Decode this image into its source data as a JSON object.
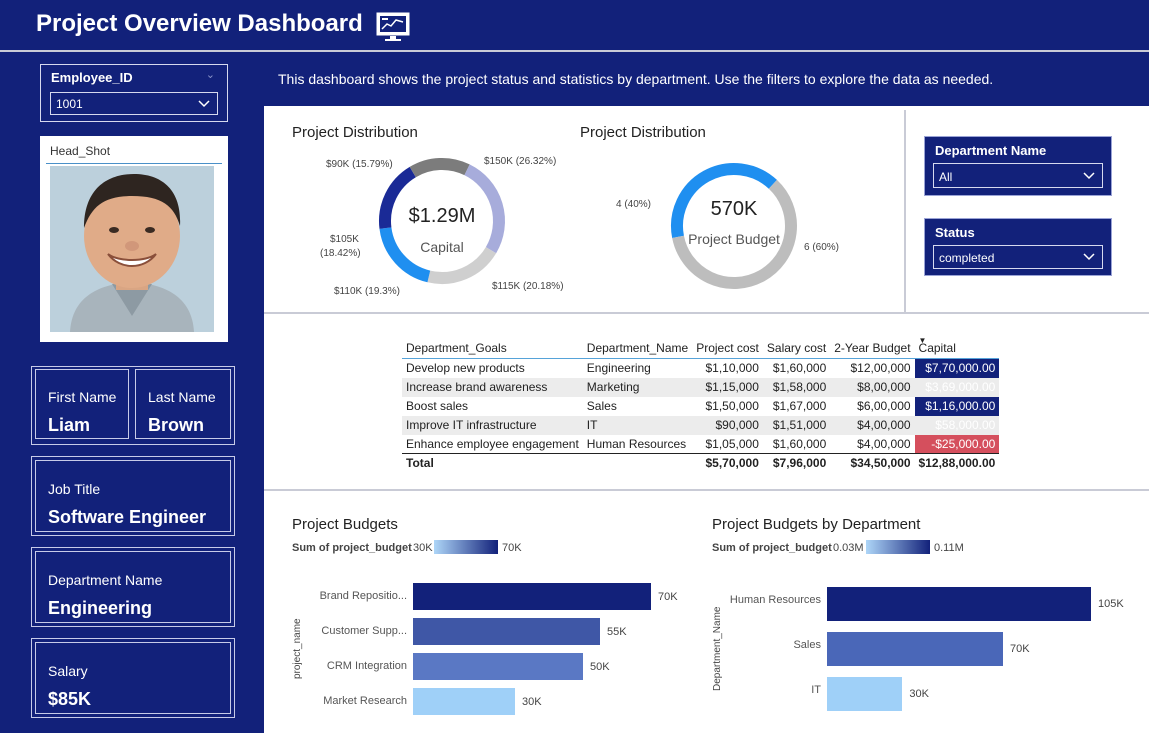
{
  "header": {
    "title": "Project Overview Dashboard",
    "icon": "dashboard-chart-icon"
  },
  "description": "This dashboard shows the project status and statistics by department. Use the filters to explore the data as needed.",
  "employee_slicer": {
    "label": "Employee_ID",
    "value": "1001"
  },
  "head_shot": {
    "label": "Head_Shot"
  },
  "employee": {
    "first_name_label": "First Name",
    "first_name": "Liam",
    "last_name_label": "Last Name",
    "last_name": "Brown",
    "job_title_label": "Job Title",
    "job_title": "Software Engineer",
    "department_label": "Department Name",
    "department": "Engineering",
    "salary_label": "Salary",
    "salary": "$85K"
  },
  "donut1": {
    "title": "Project Distribution",
    "center_value": "$1.29M",
    "center_label": "Capital",
    "labels": [
      "$150K (26.32%)",
      "$115K (20.18%)",
      "$110K (19.3%)",
      "$105K",
      "(18.42%)",
      "$90K (15.79%)"
    ]
  },
  "donut2": {
    "title": "Project Distribution",
    "center_value": "570K",
    "center_label": "Project Budget",
    "labels": [
      "4 (40%)",
      "6 (60%)"
    ]
  },
  "filters": {
    "department": {
      "label": "Department Name",
      "value": "All"
    },
    "status": {
      "label": "Status",
      "value": "completed"
    }
  },
  "table": {
    "headers": [
      "Department_Goals",
      "Department_Name",
      "Project cost",
      "Salary cost",
      "2-Year Budget",
      "Capital"
    ],
    "rows": [
      [
        "Develop new products",
        "Engineering",
        "$1,10,000",
        "$1,60,000",
        "$12,00,000",
        "$7,70,000.00"
      ],
      [
        "Increase brand awareness",
        "Marketing",
        "$1,15,000",
        "$1,58,000",
        "$8,00,000",
        "$3,69,000.00"
      ],
      [
        "Boost sales",
        "Sales",
        "$1,50,000",
        "$1,67,000",
        "$6,00,000",
        "$1,16,000.00"
      ],
      [
        "Improve IT infrastructure",
        "IT",
        "$90,000",
        "$1,51,000",
        "$4,00,000",
        "$58,000.00"
      ],
      [
        "Enhance employee engagement",
        "Human Resources",
        "$1,05,000",
        "$1,60,000",
        "$4,00,000",
        "-$25,000.00"
      ]
    ],
    "total": [
      "Total",
      "",
      "$5,70,000",
      "$7,96,000",
      "$34,50,000",
      "$12,88,000.00"
    ]
  },
  "bar1": {
    "title": "Project Budgets",
    "legend_label": "Sum of project_budget",
    "legend_min": "30K",
    "legend_max": "70K",
    "axis_label": "project_name",
    "categories": [
      "Brand Repositio...",
      "Customer Supp...",
      "CRM Integration",
      "Market Research"
    ],
    "values": [
      70,
      55,
      50,
      30
    ],
    "value_labels": [
      "70K",
      "55K",
      "50K",
      "30K"
    ],
    "colors": [
      "#12217a",
      "#3f57a6",
      "#5a78c4",
      "#9fd0f8"
    ]
  },
  "bar2": {
    "title": "Project Budgets by Department",
    "legend_label": "Sum of project_budget",
    "legend_min": "0.03M",
    "legend_max": "0.11M",
    "axis_label": "Department_Name",
    "categories": [
      "Human Resources",
      "Sales",
      "IT"
    ],
    "values": [
      105,
      70,
      30
    ],
    "value_labels": [
      "105K",
      "70K",
      "30K"
    ],
    "colors": [
      "#12217a",
      "#4a67b8",
      "#9fd0f8"
    ]
  },
  "chart_data": [
    {
      "type": "pie",
      "title": "Project Distribution",
      "categories": [
        "$150K",
        "$115K",
        "$110K",
        "$105K",
        "$90K"
      ],
      "values": [
        150,
        115,
        110,
        105,
        90
      ],
      "percent": [
        26.32,
        20.18,
        19.3,
        18.42,
        15.79
      ],
      "colors": [
        "#a7acdb",
        "#cfcfcf",
        "#1f8ff0",
        "#1a2a96",
        "#7c7c7c"
      ]
    },
    {
      "type": "pie",
      "title": "Project Distribution",
      "categories": [
        "4",
        "6"
      ],
      "values": [
        4,
        6
      ],
      "percent": [
        40,
        60
      ],
      "colors": [
        "#1f8ff0",
        "#bdbdbd"
      ]
    },
    {
      "type": "bar",
      "title": "Project Budgets",
      "categories": [
        "Brand Repositio...",
        "Customer Supp...",
        "CRM Integration",
        "Market Research"
      ],
      "values": [
        70,
        55,
        50,
        30
      ],
      "ylabel": "project_name"
    },
    {
      "type": "bar",
      "title": "Project Budgets by Department",
      "categories": [
        "Human Resources",
        "Sales",
        "IT"
      ],
      "values": [
        105,
        70,
        30
      ],
      "ylabel": "Department_Name"
    }
  ]
}
